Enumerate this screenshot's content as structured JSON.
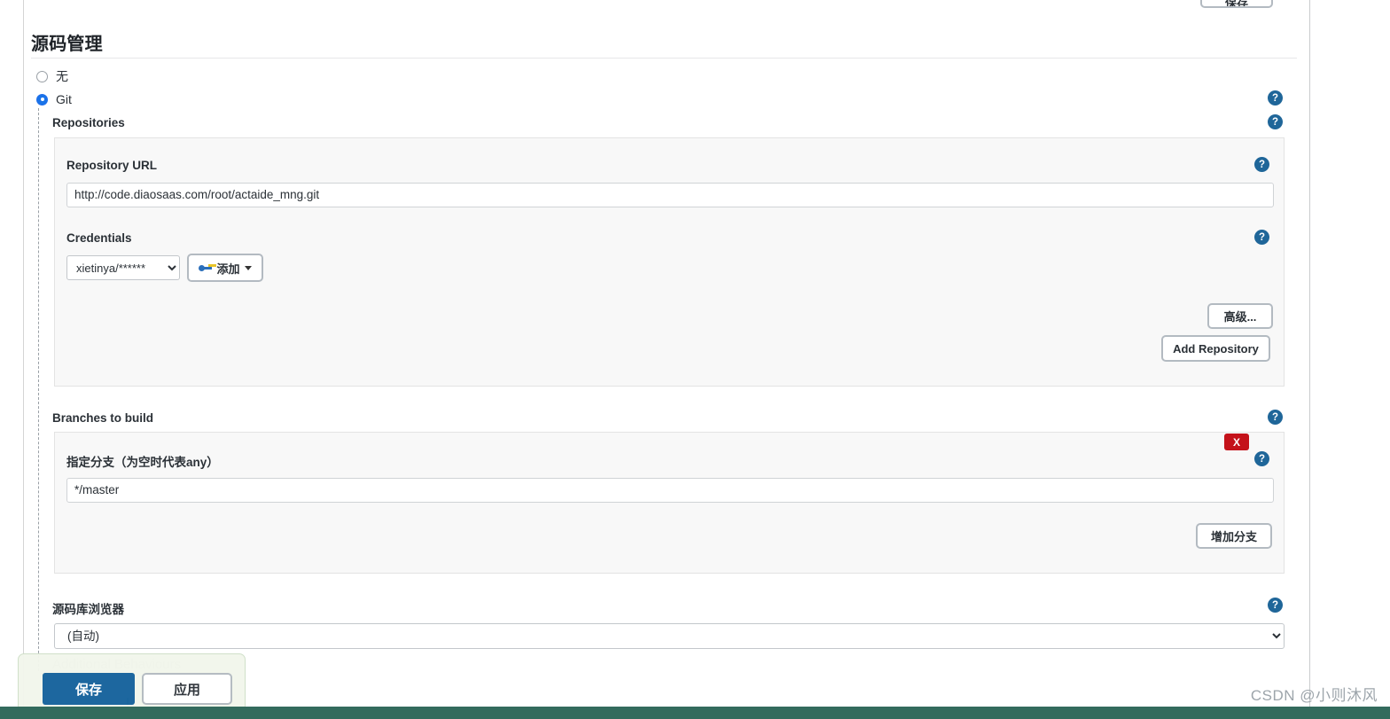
{
  "page": {
    "section_title": "源码管理",
    "cutoff_button_label": "保存"
  },
  "scm_options": [
    {
      "label": "无",
      "checked": false
    },
    {
      "label": "Git",
      "checked": true
    }
  ],
  "git": {
    "repositories_label": "Repositories",
    "repository_url_label": "Repository URL",
    "repository_url_value": "http://code.diaosaas.com/root/actaide_mng.git",
    "credentials_label": "Credentials",
    "credentials_value": "xietinya/******",
    "credentials_add_label": "添加",
    "advanced_label": "高级...",
    "add_repository_label": "Add Repository",
    "branches_label": "Branches to build",
    "branch_spec_label": "指定分支（为空时代表any）",
    "branch_spec_value": "*/master",
    "add_branch_label": "增加分支",
    "delete_label": "X",
    "repo_browser_label": "源码库浏览器",
    "repo_browser_value": "(自动)",
    "additional_behaviours_label": "Additional Behaviours"
  },
  "help": {
    "glyph": "?",
    "color": "#1f6699"
  },
  "actions": {
    "save_label": "保存",
    "apply_label": "应用"
  },
  "watermark": "CSDN @小则沐风",
  "colors": {
    "accent_blue": "#16639c",
    "help_blue": "#1f6699",
    "danger_red": "#c4121a",
    "save_bar_bg": "#f2f6ec",
    "bottom_strip": "#336b5d"
  }
}
